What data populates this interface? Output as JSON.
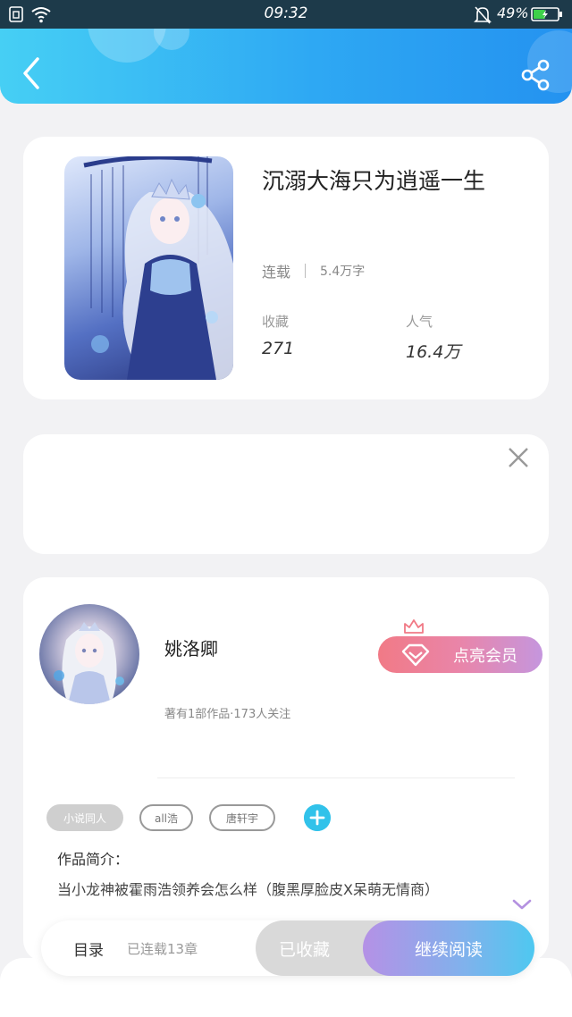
{
  "status_bar": {
    "time": "09:32",
    "battery_percent": "49%",
    "battery_level": 0.49
  },
  "book": {
    "title": "沉溺大海只为逍遥一生",
    "status": "连载",
    "word_count": "5.4万字",
    "collect_label": "收藏",
    "collect_value": "271",
    "popularity_label": "人气",
    "popularity_value": "16.4万"
  },
  "author": {
    "name": "姚洛卿",
    "subtitle": "著有1部作品·173人关注",
    "vip_button_label": "点亮会员"
  },
  "tags": [
    "小说同人",
    "all浩",
    "唐轩宇"
  ],
  "intro": {
    "label": "作品简介：",
    "text": "当小龙神被霍雨浩领养会怎么样（腹黑厚脸皮X呆萌无情商）"
  },
  "bottom_bar": {
    "toc_label": "目录",
    "toc_sub": "已连载13章",
    "collected_label": "已收藏",
    "read_label": "继续阅读"
  },
  "colors": {
    "header_start": "#46cff4",
    "header_end": "#2492f0",
    "vip_start": "#f17a86",
    "vip_end": "#c596de",
    "accent": "#31c2ea",
    "read_start": "#b591e6",
    "read_end": "#4ec8f0"
  },
  "icons": {
    "back": "back-arrow-icon",
    "share": "share-icon",
    "close": "close-icon",
    "add": "plus-icon",
    "expand": "chevron-down-icon",
    "diamond": "diamond-icon",
    "crown": "crown-icon"
  }
}
